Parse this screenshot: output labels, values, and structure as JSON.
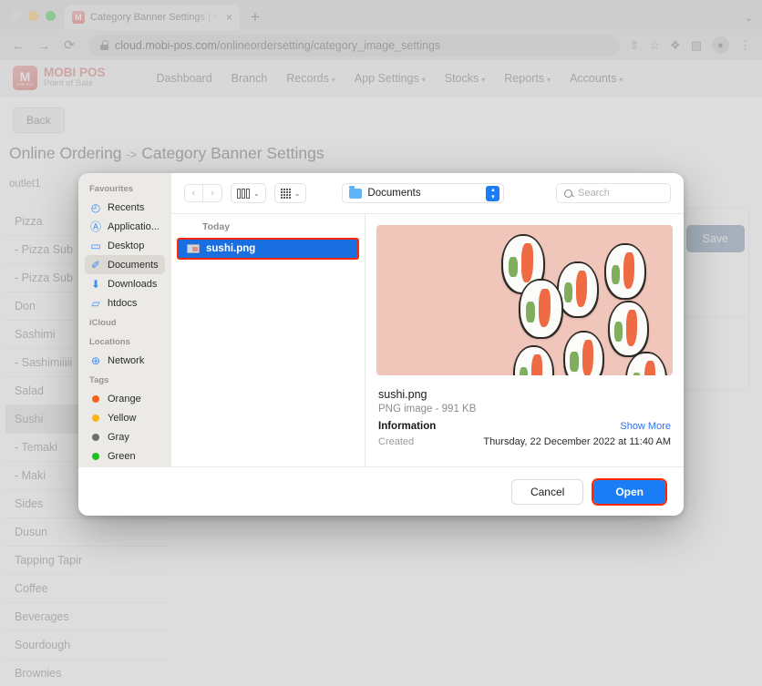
{
  "browser": {
    "traffic_lights": [
      "close",
      "minimize",
      "maximize"
    ],
    "tab": {
      "title": "Category Banner Settings | Mo",
      "favicon": "M",
      "close": "×"
    },
    "new_tab": "+",
    "tab_list_chevron": "⌄",
    "nav": {
      "back": "←",
      "forward": "→",
      "reload": "⟳"
    },
    "url": {
      "host": "cloud.mobi-pos.com",
      "path": "/onlineordersetting/category_image_settings"
    },
    "omnibox_icons": [
      "share-icon",
      "bookmark-star-icon",
      "extensions-puzzle-icon",
      "side-panel-icon",
      "profile-avatar-icon",
      "chrome-menu-icon"
    ],
    "icon_glyphs": {
      "share": "⇧",
      "star": "☆",
      "puzzle": "❖",
      "sidepanel": "▧",
      "avatar": "●",
      "menu": "⋮"
    }
  },
  "site": {
    "logo": {
      "brand": "MOBI POS",
      "tagline": "Point of Sale",
      "mark_letter": "M",
      "mark_sub": "MOBI POS"
    },
    "nav": [
      {
        "label": "Dashboard",
        "has_caret": false
      },
      {
        "label": "Branch",
        "has_caret": false
      },
      {
        "label": "Records",
        "has_caret": true
      },
      {
        "label": "App Settings",
        "has_caret": true
      },
      {
        "label": "Stocks",
        "has_caret": true
      },
      {
        "label": "Reports",
        "has_caret": true
      },
      {
        "label": "Accounts",
        "has_caret": true
      }
    ],
    "caret_glyph": "▾"
  },
  "page": {
    "back_button": "Back",
    "title_prefix": "Online Ordering",
    "title_arrow": "->",
    "title_suffix": "Category Banner Settings",
    "outlet": "outlet1",
    "save_button": "Save",
    "categories": [
      {
        "label": "Pizza",
        "selected": false
      },
      {
        "label": "- Pizza Sub",
        "selected": false
      },
      {
        "label": "- Pizza Sub",
        "selected": false
      },
      {
        "label": "Don",
        "selected": false
      },
      {
        "label": "Sashimi",
        "selected": false
      },
      {
        "label": "- Sashimiiiii",
        "selected": false
      },
      {
        "label": "Salad",
        "selected": false
      },
      {
        "label": "Sushi",
        "selected": true
      },
      {
        "label": "- Temaki",
        "selected": false
      },
      {
        "label": "- Maki",
        "selected": false
      },
      {
        "label": "Sides",
        "selected": false
      },
      {
        "label": "Dusun",
        "selected": false
      },
      {
        "label": "Tapping Tapir",
        "selected": false
      },
      {
        "label": "Coffee",
        "selected": false
      },
      {
        "label": "Beverages",
        "selected": false
      },
      {
        "label": "Sourdough",
        "selected": false
      },
      {
        "label": "Brownies",
        "selected": false
      }
    ]
  },
  "file_dialog": {
    "toolbar": {
      "back_glyph": "‹",
      "forward_glyph": "›",
      "view_column_label": "column-view",
      "view_icon_label": "icon-view",
      "chevron": "⌄",
      "path_label": "Documents",
      "stepper_glyph": "⌃⌄",
      "search_placeholder": "Search"
    },
    "sidebar": {
      "sections": [
        {
          "header": "Favourites",
          "items": [
            {
              "label": "Recents",
              "icon": "clock-icon",
              "glyph": "◴",
              "active": false
            },
            {
              "label": "Applicatio...",
              "icon": "applications-icon",
              "glyph": "Ⓐ",
              "active": false
            },
            {
              "label": "Desktop",
              "icon": "desktop-icon",
              "glyph": "▭",
              "active": false
            },
            {
              "label": "Documents",
              "icon": "documents-icon",
              "glyph": "✐",
              "active": true
            },
            {
              "label": "Downloads",
              "icon": "downloads-icon",
              "glyph": "⬇",
              "active": false
            },
            {
              "label": "htdocs",
              "icon": "folder-icon",
              "glyph": "▱",
              "active": false
            }
          ]
        },
        {
          "header": "iCloud",
          "items": []
        },
        {
          "header": "Locations",
          "items": [
            {
              "label": "Network",
              "icon": "network-globe-icon",
              "glyph": "⊕",
              "active": false
            }
          ]
        },
        {
          "header": "Tags",
          "items": [
            {
              "label": "Orange",
              "icon": "tag-dot-icon",
              "color": "#f5621f",
              "active": false
            },
            {
              "label": "Yellow",
              "icon": "tag-dot-icon",
              "color": "#fcb414",
              "active": false
            },
            {
              "label": "Gray",
              "icon": "tag-dot-icon",
              "color": "#6e6e6e",
              "active": false
            },
            {
              "label": "Green",
              "icon": "tag-dot-icon",
              "color": "#20c020",
              "active": false
            }
          ]
        }
      ]
    },
    "file_list": {
      "group_header": "Today",
      "files": [
        {
          "name": "sushi.png",
          "selected": true,
          "highlighted": true
        }
      ]
    },
    "preview": {
      "image_alt": "sushi rolls on pink background",
      "file_name": "sushi.png",
      "kind_size": "PNG image - 991 KB",
      "information_label": "Information",
      "show_more": "Show More",
      "created_label": "Created",
      "created_value": "Thursday, 22 December 2022 at 11:40 AM"
    },
    "footer": {
      "cancel": "Cancel",
      "open": "Open"
    }
  },
  "colors": {
    "accent_blue": "#1a7df5",
    "highlight_red": "#ff2600",
    "brand_red": "#d76a66",
    "save_blue": "#6e8cab",
    "selection_blue": "#1a6fe0"
  }
}
